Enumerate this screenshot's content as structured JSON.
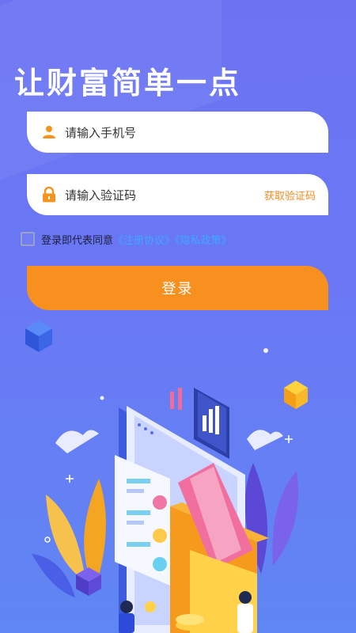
{
  "headline": "让财富简单一点",
  "phone_field": {
    "placeholder": "请输入手机号",
    "icon": "user-icon"
  },
  "code_field": {
    "placeholder": "请输入验证码",
    "icon": "lock-icon",
    "get_code_label": "获取验证码"
  },
  "agreement": {
    "prefix": "登录即代表同意",
    "links": "《注册协议》《隐私政策》",
    "checked": false
  },
  "login_button": {
    "label": "登录"
  },
  "colors": {
    "background": "#6b74f2",
    "accent_orange": "#f8901f",
    "link_blue": "#3ea8ff"
  }
}
